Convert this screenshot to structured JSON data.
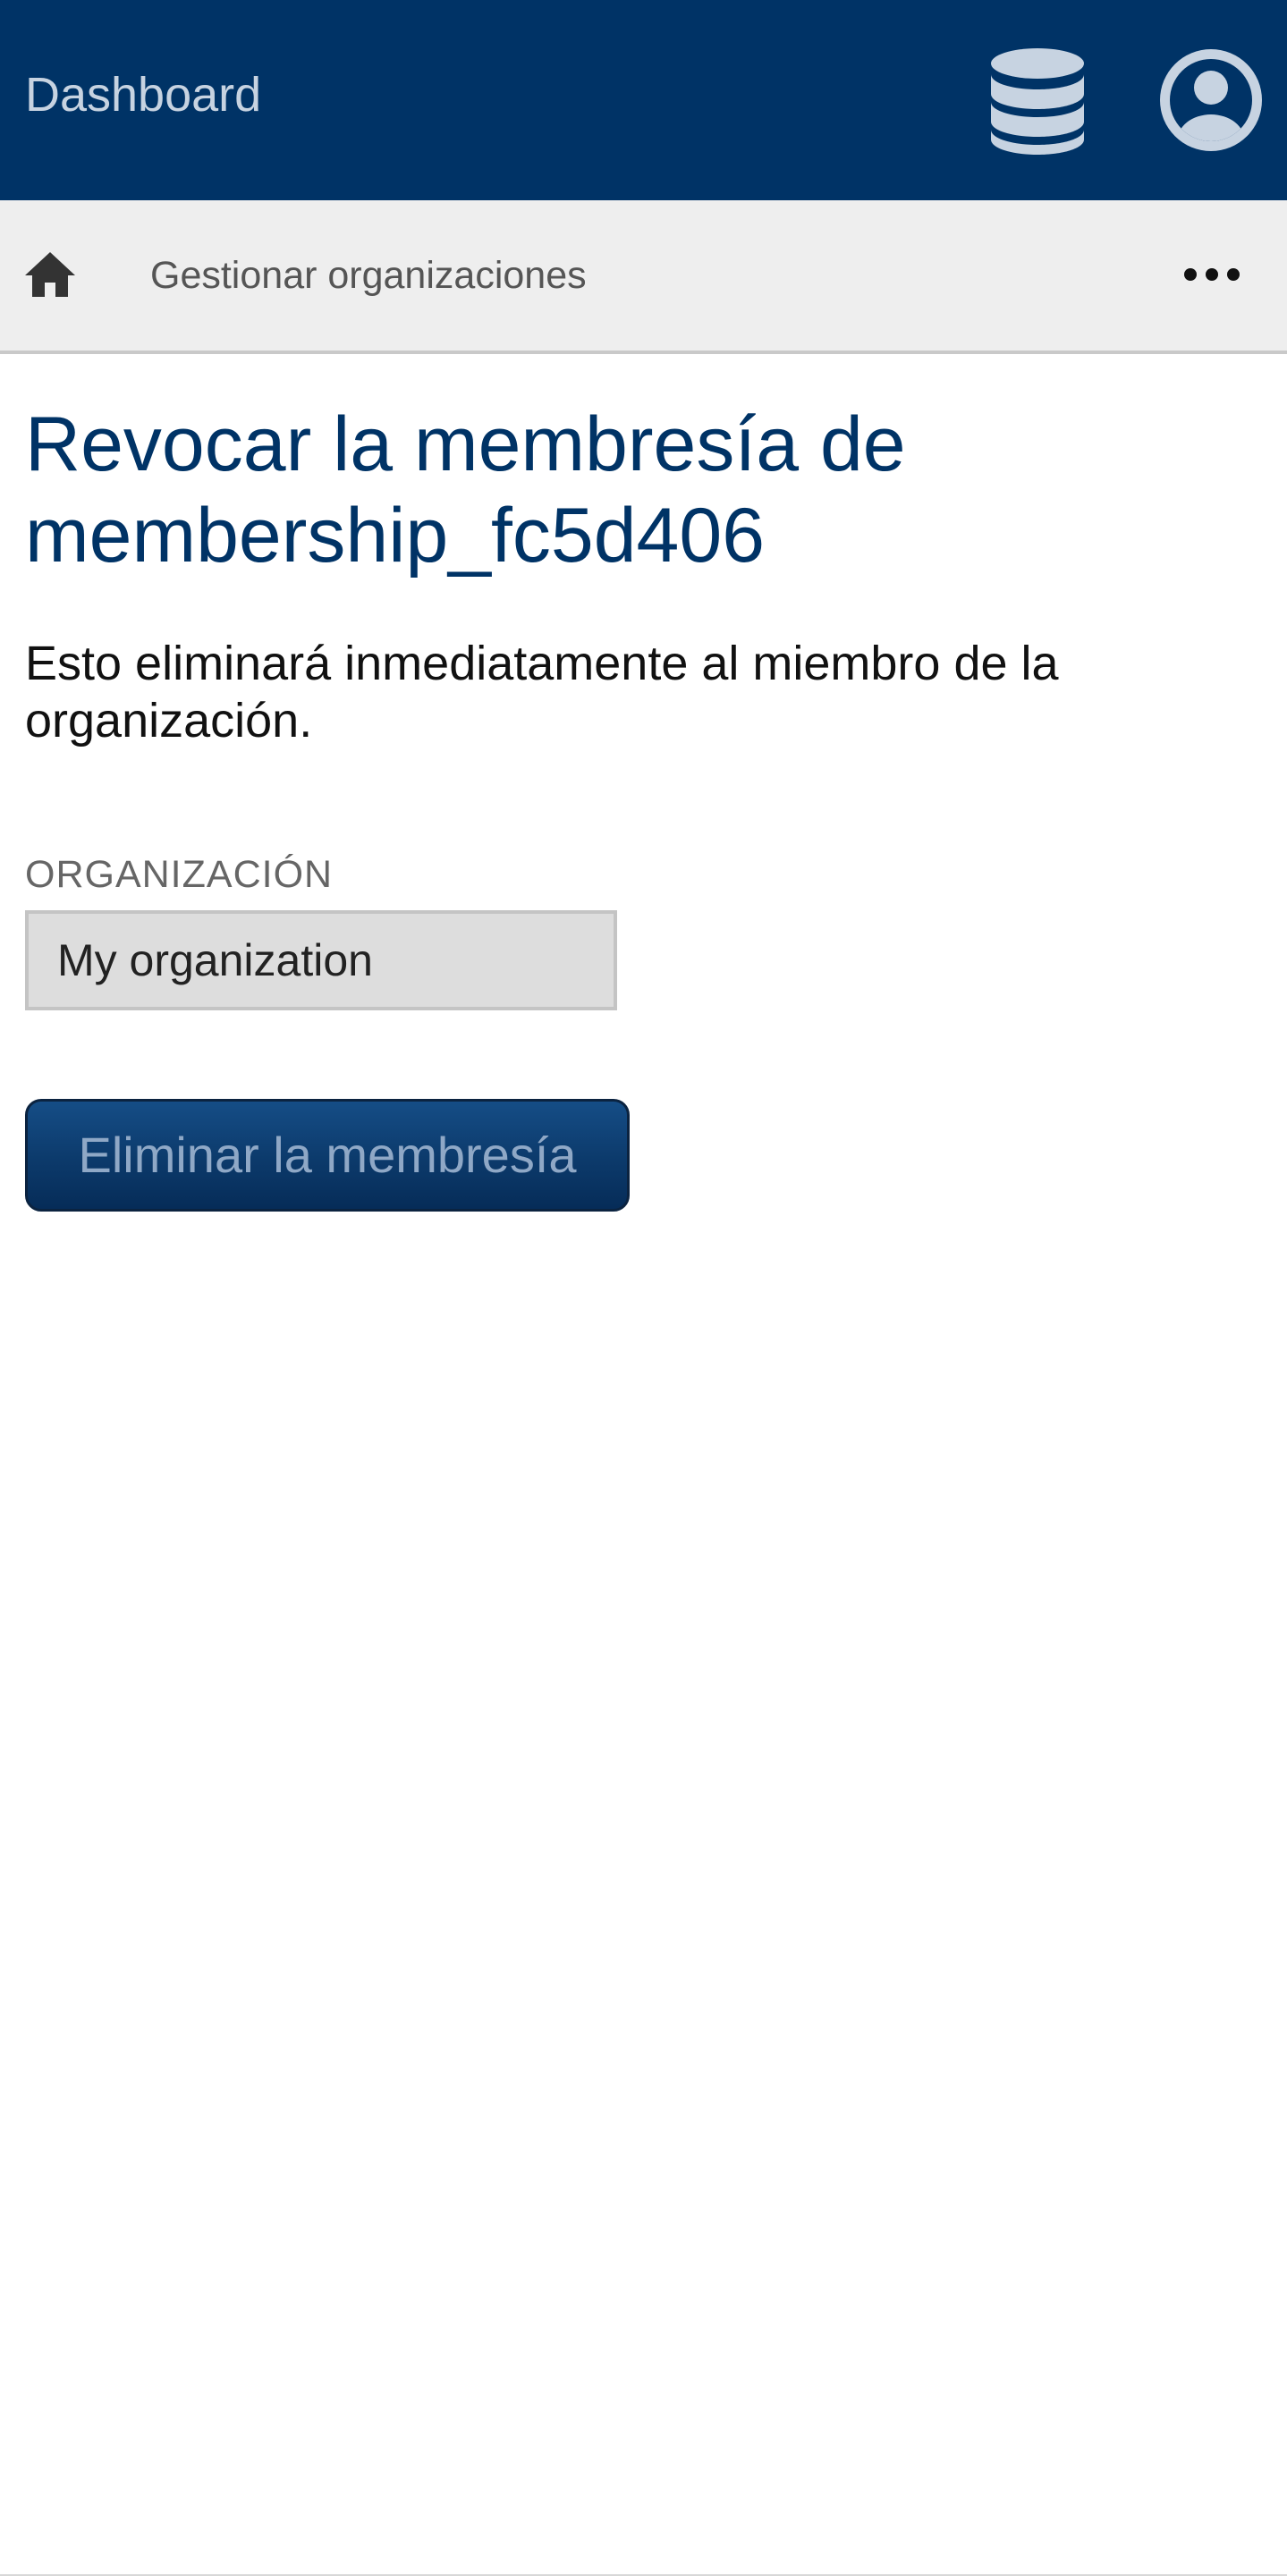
{
  "header": {
    "brand": "Dashboard",
    "database_icon": "database-icon",
    "user_icon": "user-circle-icon",
    "background_color": "#003366",
    "text_color": "#c7d3e1"
  },
  "breadcrumb": {
    "home_icon": "home-icon",
    "current": "Gestionar organizaciones",
    "more_icon": "ellipsis-icon"
  },
  "main": {
    "title": "Revocar la membresía de membership_fc5d406",
    "description": "Esto eliminará inmediatamente al miembro de la organización.",
    "organization_field": {
      "label": "ORGANIZACIÓN",
      "value": "My organization"
    },
    "submit_label": "Eliminar la membresía",
    "accent_color": "#003366"
  }
}
